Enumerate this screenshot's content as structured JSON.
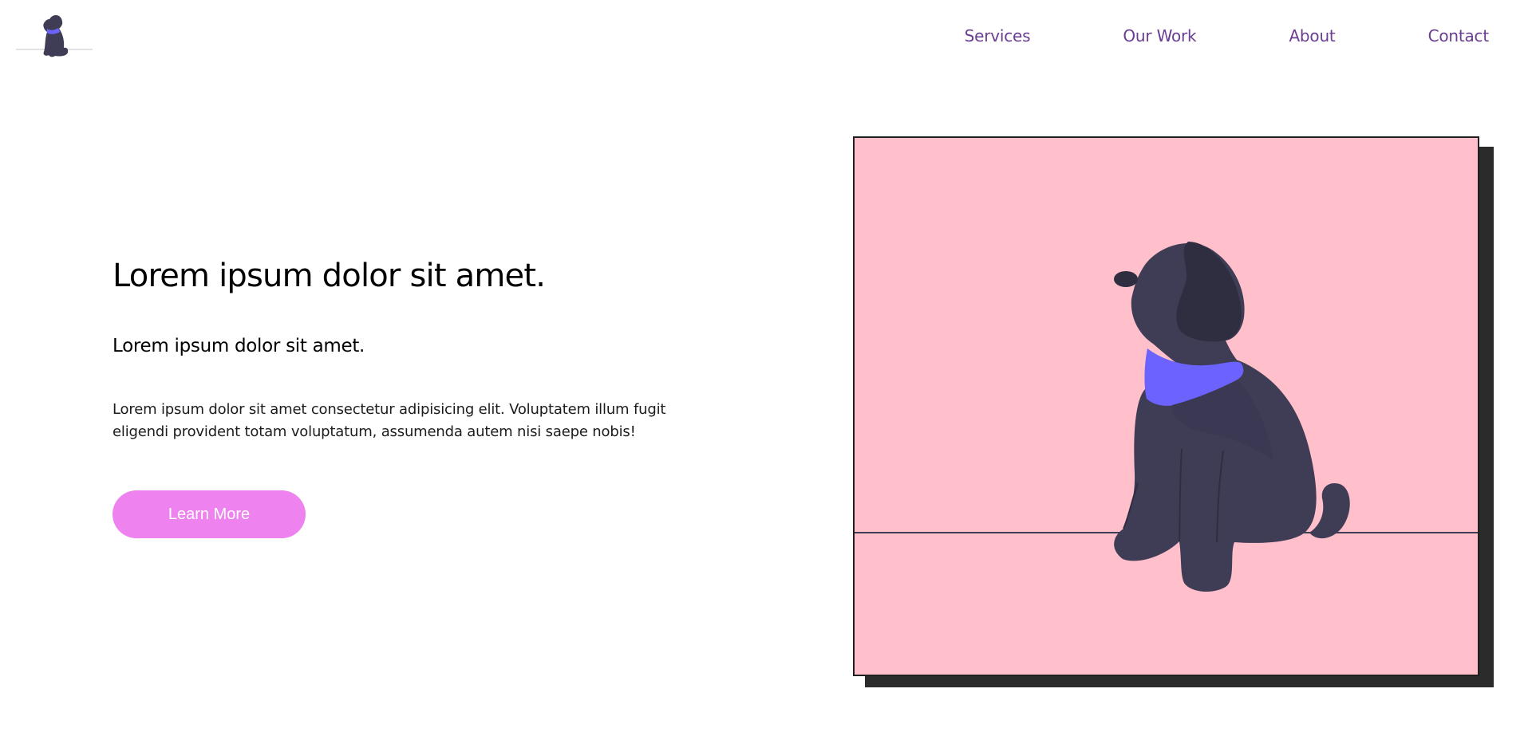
{
  "header": {
    "logo_icon": "dog-logo-icon",
    "nav": [
      {
        "label": "Services"
      },
      {
        "label": "Our Work"
      },
      {
        "label": "About"
      },
      {
        "label": "Contact"
      }
    ]
  },
  "hero": {
    "headline": "Lorem ipsum dolor sit amet.",
    "subheadline": "Lorem ipsum dolor sit amet.",
    "description": "Lorem ipsum dolor sit amet consectetur adipisicing elit. Voluptatem illum fugit eligendi provident totam voluptatum, assumenda autem nisi saepe nobis!",
    "cta_label": "Learn More",
    "illustration_icon": "sitting-dog-illustration"
  },
  "colors": {
    "nav_text": "#6a3d92",
    "button": "#ee82ee",
    "illustration_background": "#ffbfcb",
    "dog": "#3f3d56",
    "collar": "#6c63ff"
  }
}
